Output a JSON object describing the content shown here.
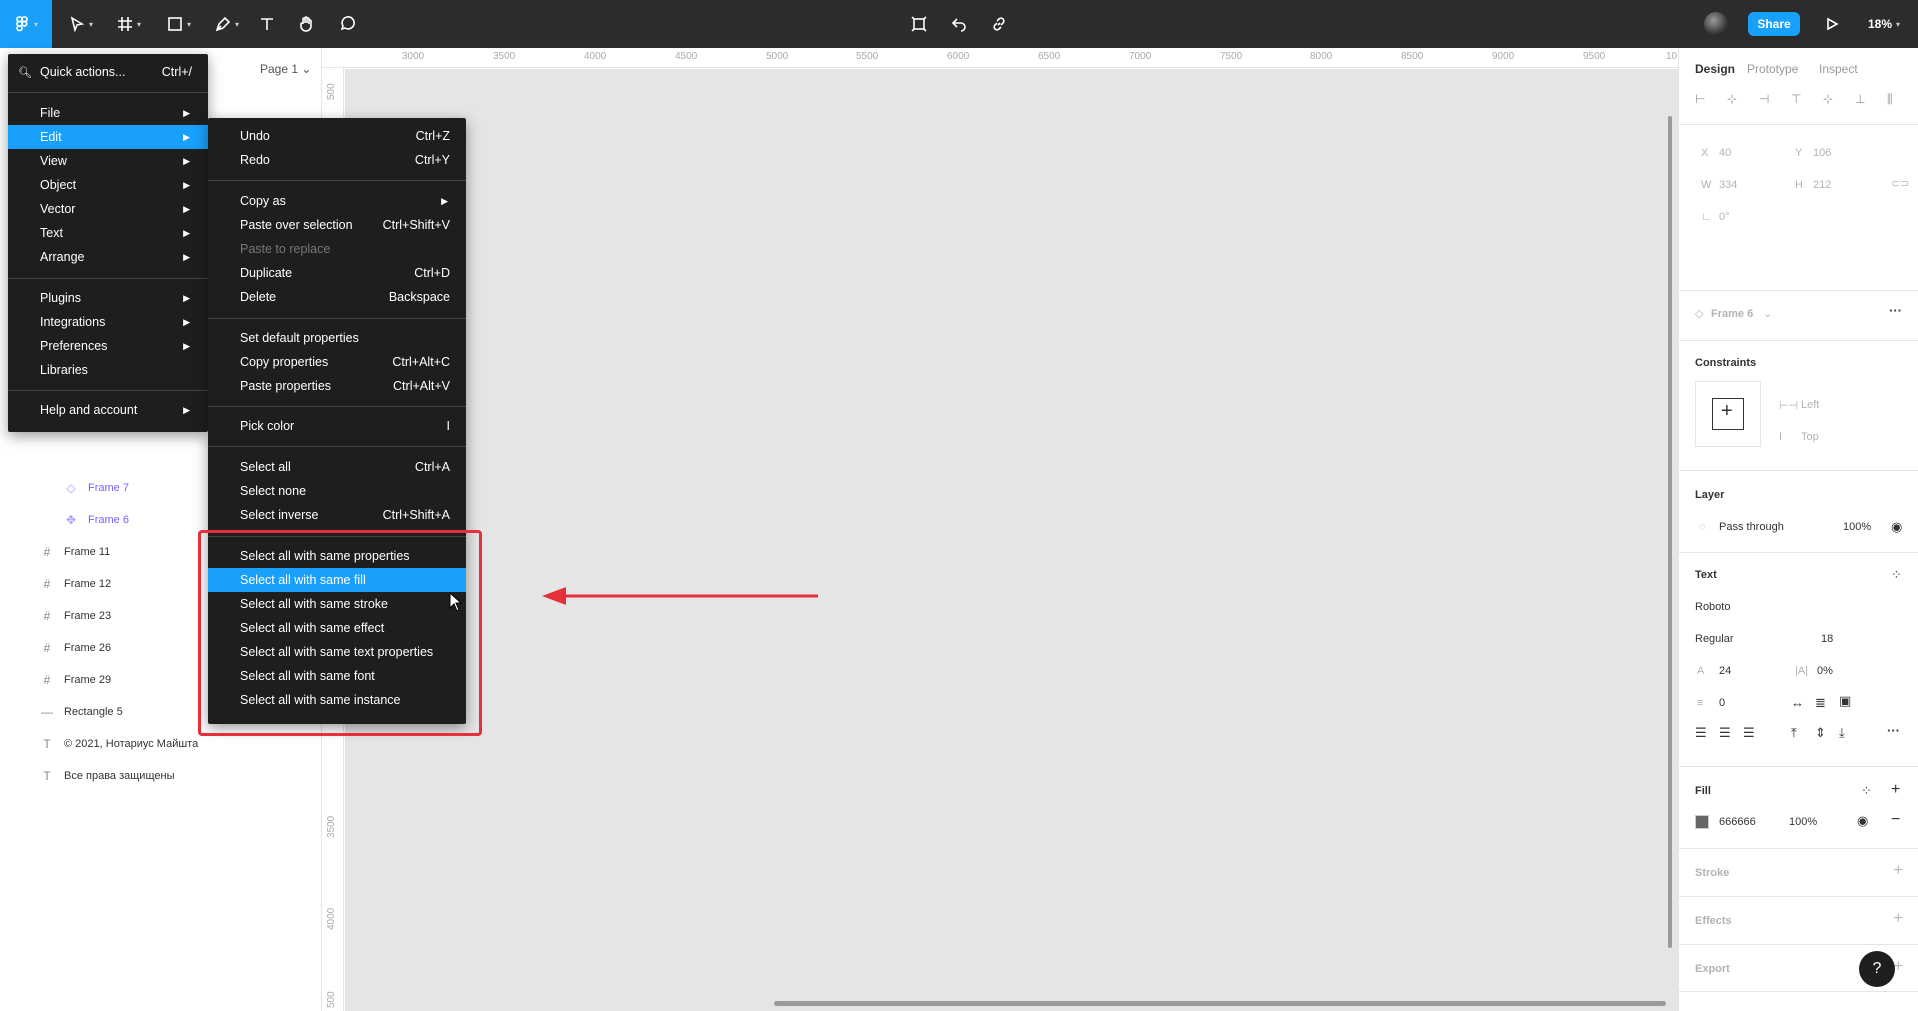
{
  "toolbar": {
    "share_label": "Share",
    "zoom_label": "18%"
  },
  "left_panel": {
    "page_selector": "Page 1 ⌄",
    "layers": [
      {
        "name": "Frame 7",
        "type": "component"
      },
      {
        "name": "Frame 6",
        "type": "component"
      },
      {
        "name": "Frame 11",
        "type": "frame"
      },
      {
        "name": "Frame 12",
        "type": "frame"
      },
      {
        "name": "Frame 23",
        "type": "frame"
      },
      {
        "name": "Frame 26",
        "type": "frame"
      },
      {
        "name": "Frame 29",
        "type": "frame"
      },
      {
        "name": "Rectangle 5",
        "type": "line"
      },
      {
        "name": "© 2021, Нотариус Майшта",
        "type": "text"
      },
      {
        "name": "Все права защищены",
        "type": "text"
      }
    ]
  },
  "ruler": {
    "x": [
      "3000",
      "3500",
      "4000",
      "4500",
      "5000",
      "5500",
      "6000",
      "6500",
      "7000",
      "7500",
      "8000",
      "8500",
      "9000",
      "9500",
      "10"
    ],
    "y": [
      "500",
      "3500",
      "4000",
      "500"
    ]
  },
  "main_menu": {
    "quick_actions": {
      "label": "Quick actions...",
      "shortcut": "Ctrl+/"
    },
    "group1": [
      {
        "label": "File",
        "highlighted": false
      },
      {
        "label": "Edit",
        "highlighted": true
      },
      {
        "label": "View",
        "highlighted": false
      },
      {
        "label": "Object",
        "highlighted": false
      },
      {
        "label": "Vector",
        "highlighted": false
      },
      {
        "label": "Text",
        "highlighted": false
      },
      {
        "label": "Arrange",
        "highlighted": false
      }
    ],
    "group2": [
      {
        "label": "Plugins",
        "submenu": true
      },
      {
        "label": "Integrations",
        "submenu": true
      },
      {
        "label": "Preferences",
        "submenu": true
      },
      {
        "label": "Libraries",
        "submenu": false
      }
    ],
    "group3": [
      {
        "label": "Help and account",
        "submenu": true
      }
    ]
  },
  "edit_menu": {
    "groups": [
      [
        {
          "label": "Undo",
          "shortcut": "Ctrl+Z"
        },
        {
          "label": "Redo",
          "shortcut": "Ctrl+Y"
        }
      ],
      [
        {
          "label": "Copy as",
          "shortcut": "",
          "submenu": true
        },
        {
          "label": "Paste over selection",
          "shortcut": "Ctrl+Shift+V"
        },
        {
          "label": "Paste to replace",
          "shortcut": "",
          "disabled": true
        },
        {
          "label": "Duplicate",
          "shortcut": "Ctrl+D"
        },
        {
          "label": "Delete",
          "shortcut": "Backspace"
        }
      ],
      [
        {
          "label": "Set default properties",
          "shortcut": ""
        },
        {
          "label": "Copy properties",
          "shortcut": "Ctrl+Alt+C"
        },
        {
          "label": "Paste properties",
          "shortcut": "Ctrl+Alt+V"
        }
      ],
      [
        {
          "label": "Pick color",
          "shortcut": "I"
        }
      ],
      [
        {
          "label": "Select all",
          "shortcut": "Ctrl+A"
        },
        {
          "label": "Select none",
          "shortcut": ""
        },
        {
          "label": "Select inverse",
          "shortcut": "Ctrl+Shift+A"
        }
      ],
      [
        {
          "label": "Select all with same properties",
          "shortcut": ""
        },
        {
          "label": "Select all with same fill",
          "shortcut": "",
          "highlighted": true
        },
        {
          "label": "Select all with same stroke",
          "shortcut": ""
        },
        {
          "label": "Select all with same effect",
          "shortcut": ""
        },
        {
          "label": "Select all with same text properties",
          "shortcut": ""
        },
        {
          "label": "Select all with same font",
          "shortcut": ""
        },
        {
          "label": "Select all with same instance",
          "shortcut": ""
        }
      ]
    ]
  },
  "right_panel": {
    "tabs": [
      "Design",
      "Prototype",
      "Inspect"
    ],
    "x_label": "X",
    "x_value": "40",
    "y_label": "Y",
    "y_value": "106",
    "w_label": "W",
    "w_value": "334",
    "h_label": "H",
    "h_value": "212",
    "rotation": "0°",
    "frame_selector": "Frame 6",
    "constraints_title": "Constraints",
    "constraint_h": "Left",
    "constraint_v": "Top",
    "layer_title": "Layer",
    "blend_mode": "Pass through",
    "layer_opacity": "100%",
    "text_title": "Text",
    "font_family": "Roboto",
    "font_weight": "Regular",
    "font_size": "18",
    "line_height": "24",
    "letter_spacing": "0%",
    "paragraph_spacing": "0",
    "fill_title": "Fill",
    "fill_color_hex": "666666",
    "fill_color": "#666666",
    "fill_opacity": "100%",
    "stroke_title": "Stroke",
    "effects_title": "Effects",
    "export_title": "Export",
    "help_label": "?"
  }
}
